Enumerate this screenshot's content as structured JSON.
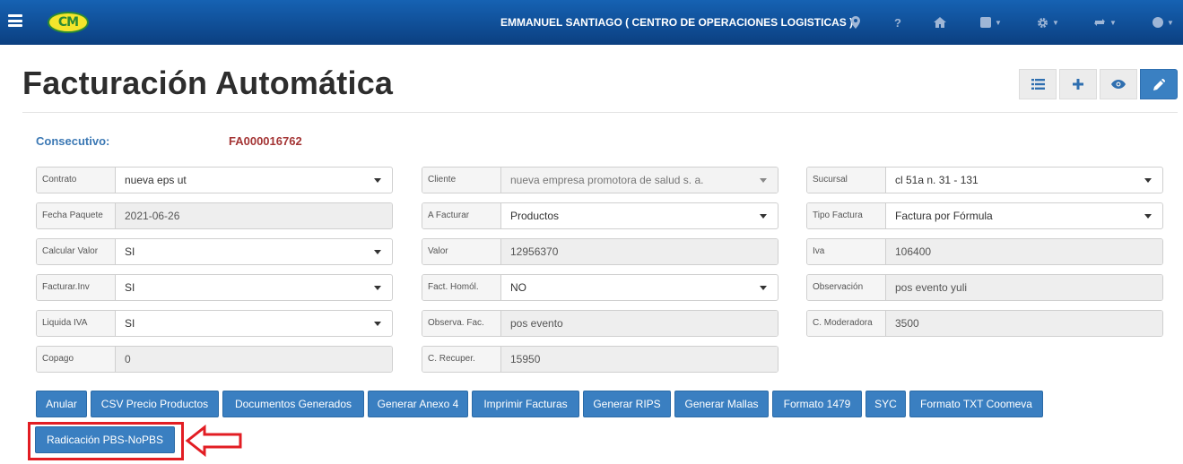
{
  "navbar": {
    "user": "EMMANUEL SANTIAGO ( CENTRO DE OPERACIONES LOGISTICAS )",
    "logo_text": "CM",
    "icons": [
      "hamburger-icon",
      "map-marker-icon",
      "question-icon",
      "home-icon",
      "square-icon",
      "gear-icon",
      "refresh-icon",
      "user-circle-icon"
    ]
  },
  "page": {
    "title": "Facturación Automática",
    "consecutivo_label": "Consecutivo:",
    "consecutivo_value": "FA000016762"
  },
  "toolbar": {
    "icons": [
      "list-icon",
      "plus-icon",
      "eye-icon",
      "pencil-icon"
    ],
    "active_color": "#3a80c2"
  },
  "form": {
    "contrato": {
      "label": "Contrato",
      "value": "nueva eps ut"
    },
    "cliente": {
      "label": "Cliente",
      "value": "nueva empresa promotora de salud s. a."
    },
    "sucursal": {
      "label": "Sucursal",
      "value": "cl 51a n. 31 - 131"
    },
    "fecha_paquete": {
      "label": "Fecha Paquete",
      "value": "2021-06-26"
    },
    "a_facturar": {
      "label": "A Facturar",
      "value": "Productos"
    },
    "tipo_factura": {
      "label": "Tipo Factura",
      "value": "Factura por Fórmula"
    },
    "calcular_valor": {
      "label": "Calcular Valor",
      "value": "SI"
    },
    "valor": {
      "label": "Valor",
      "value": "12956370"
    },
    "iva": {
      "label": "Iva",
      "value": "106400"
    },
    "facturar_inv": {
      "label": "Facturar.Inv",
      "value": "SI"
    },
    "fact_homol": {
      "label": "Fact. Homól.",
      "value": "NO"
    },
    "observacion": {
      "label": "Observación",
      "value": "pos evento yuli"
    },
    "liquida_iva": {
      "label": "Liquida IVA",
      "value": "SI"
    },
    "observa_fac": {
      "label": "Observa. Fac.",
      "value": "pos evento"
    },
    "c_moderadora": {
      "label": "C. Moderadora",
      "value": "3500"
    },
    "copago": {
      "label": "Copago",
      "value": "0"
    },
    "c_recuper": {
      "label": "C. Recuper.",
      "value": "15950"
    }
  },
  "actions": {
    "anular": "Anular",
    "csv_precio": "CSV Precio Productos",
    "documentos": "Documentos Generados",
    "anexo4": "Generar Anexo 4",
    "imprimir": "Imprimir Facturas",
    "rips": "Generar RIPS",
    "mallas": "Generar Mallas",
    "formato1479": "Formato 1479",
    "syc": "SYC",
    "txt_coomeva": "Formato TXT Coomeva",
    "radicacion": "Radicación PBS-NoPBS"
  },
  "colors": {
    "navbar": "#0d4a8f",
    "button": "#3a7fc1",
    "consecutivo_value": "#a43535",
    "highlight": "#e21d23"
  }
}
